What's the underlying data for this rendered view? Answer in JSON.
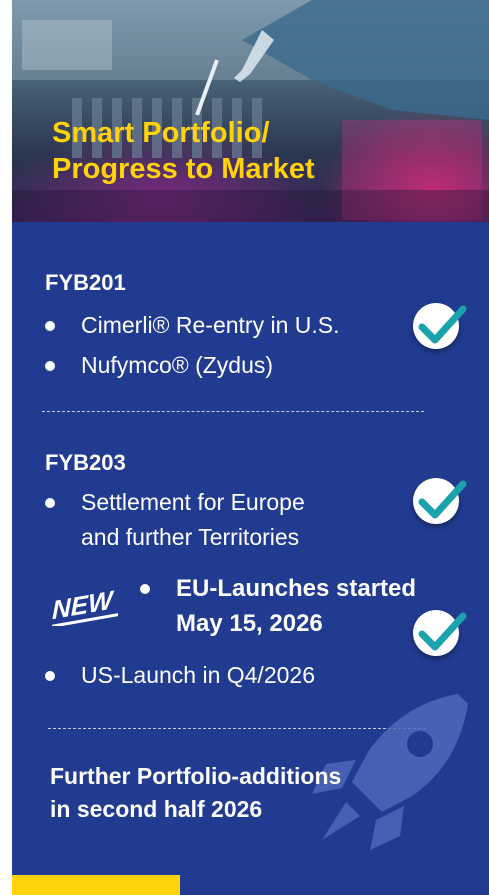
{
  "hero": {
    "title_line1": "Smart Portfolio/",
    "title_line2": "Progress to Market"
  },
  "sections": [
    {
      "heading": "FYB201",
      "items": [
        "Cimerli® Re-entry in U.S.",
        "Nufymco® (Zydus)"
      ]
    },
    {
      "heading": "FYB203",
      "items": [
        "Settlement for Europe",
        "and further Territories"
      ],
      "new_badge": "NEW",
      "new_item_line1": "EU-Launches started",
      "new_item_line2": "May 15, 2026",
      "last_item": "US-Launch in Q4/2026"
    }
  ],
  "further": {
    "line1": "Further Portfolio-additions",
    "line2": "in second half 2026"
  },
  "colors": {
    "panel_bg": "#213b91",
    "title_yellow": "#ffd20a",
    "check_teal": "#1aa3ad",
    "new_badge": "#ffffff"
  },
  "icons": [
    "checkmark-icon",
    "rocket-icon"
  ]
}
